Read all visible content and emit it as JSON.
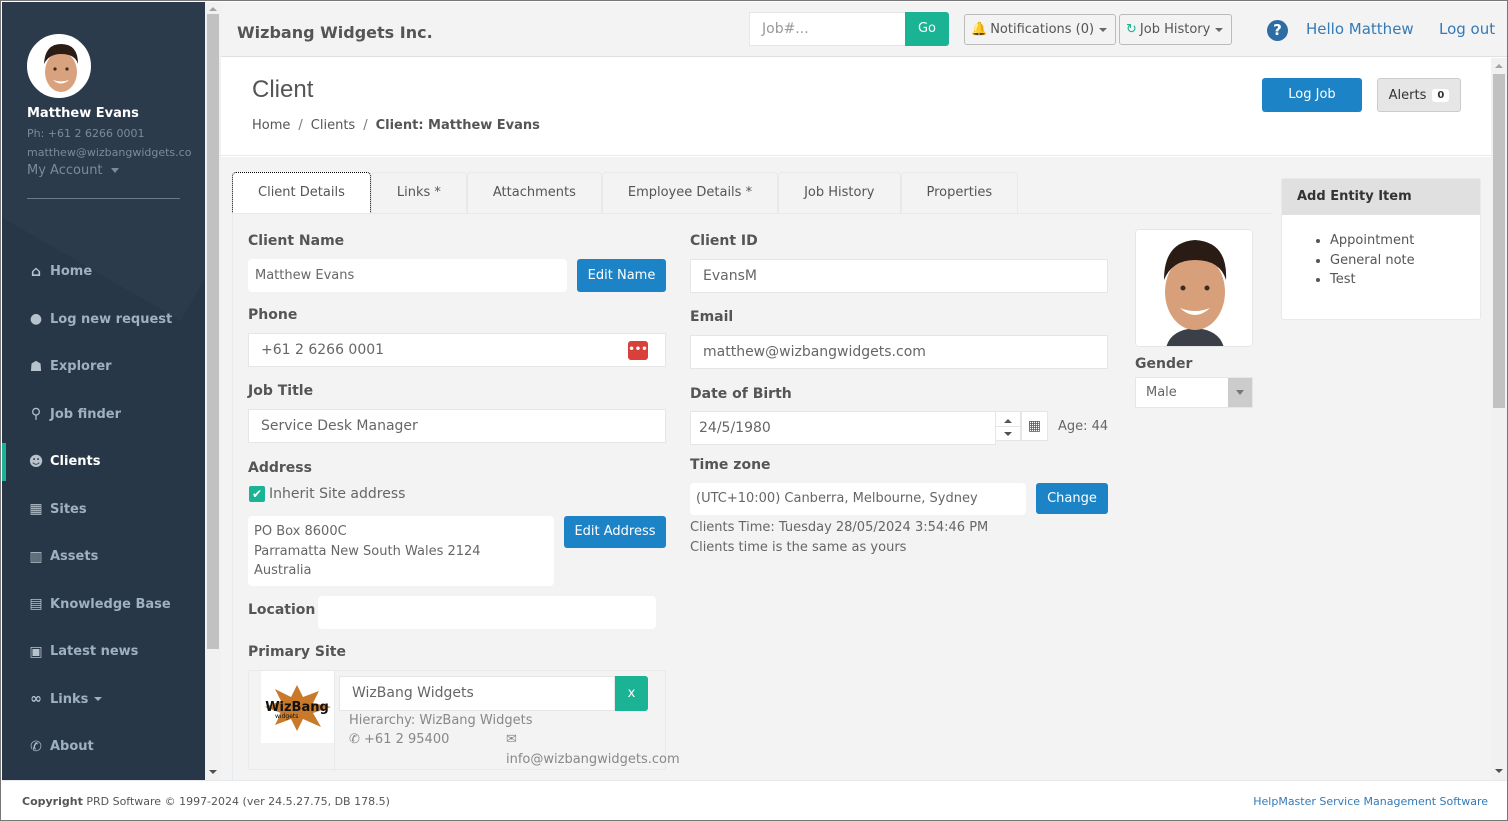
{
  "user": {
    "name": "Matthew Evans",
    "phone": "Ph: +61 2 6266 0001",
    "email": "matthew@wizbangwidgets.co",
    "account_menu": "My Account"
  },
  "sidebar": {
    "items": [
      {
        "label": "Home",
        "icon": "home-icon"
      },
      {
        "label": "Log new request",
        "icon": "circle-icon"
      },
      {
        "label": "Explorer",
        "icon": "explorer-icon"
      },
      {
        "label": "Job finder",
        "icon": "search-icon"
      },
      {
        "label": "Clients",
        "icon": "user-icon",
        "active": true
      },
      {
        "label": "Sites",
        "icon": "building-icon"
      },
      {
        "label": "Assets",
        "icon": "barcode-icon"
      },
      {
        "label": "Knowledge Base",
        "icon": "book-icon"
      },
      {
        "label": "Latest news",
        "icon": "newspaper-icon"
      },
      {
        "label": "Links",
        "icon": "link-icon"
      },
      {
        "label": "About",
        "icon": "phone-icon"
      }
    ]
  },
  "topbar": {
    "brand": "Wizbang Widgets Inc.",
    "job_search_placeholder": "Job#...",
    "go_label": "Go",
    "notifications_label": "Notifications (0)",
    "job_history_label": "Job History",
    "help_glyph": "?",
    "hello": "Hello Matthew",
    "logout": "Log out"
  },
  "header": {
    "title": "Client",
    "breadcrumb": [
      "Home",
      "Clients",
      "Client: Matthew Evans"
    ],
    "log_job_label": "Log Job",
    "alerts_label": "Alerts",
    "alerts_count": "0"
  },
  "tabs": [
    "Client Details",
    "Links *",
    "Attachments",
    "Employee Details *",
    "Job History",
    "Properties"
  ],
  "form": {
    "client_name_label": "Client Name",
    "client_name_value": "Matthew Evans",
    "edit_name_label": "Edit Name",
    "phone_label": "Phone",
    "phone_value": "+61 2 6266 0001",
    "job_title_label": "Job Title",
    "job_title_value": "Service Desk Manager",
    "address_label": "Address",
    "inherit_label": "Inherit Site address",
    "inherit_checked": true,
    "address_lines": [
      "PO Box 8600C",
      "Parramatta New South Wales 2124",
      "Australia"
    ],
    "edit_address_label": "Edit Address",
    "location_label": "Location",
    "location_value": "",
    "primary_site_label": "Primary Site",
    "site_name": "WizBang Widgets",
    "site_clear": "x",
    "site_hierarchy": "Hierarchy: WizBang Widgets",
    "site_phone": "+61 2 95400",
    "site_email": "info@wizbangwidgets.com",
    "site_logo_text": "WizBang",
    "site_logo_sub": "widgets",
    "client_id_label": "Client ID",
    "client_id_value": "EvansM",
    "email_label": "Email",
    "email_value": "matthew@wizbangwidgets.com",
    "dob_label": "Date of Birth",
    "dob_value": "24/5/1980",
    "age": "Age: 44",
    "timezone_label": "Time zone",
    "timezone_value": "(UTC+10:00) Canberra, Melbourne, Sydney",
    "change_label": "Change",
    "clients_time": "Clients Time: Tuesday 28/05/2024 3:54:46 PM",
    "clients_time_note": "Clients time is the same as yours",
    "gender_label": "Gender",
    "gender_value": "Male"
  },
  "entity": {
    "title": "Add Entity Item",
    "items": [
      "Appointment",
      "General note",
      "Test"
    ]
  },
  "footer": {
    "copyright_bold": "Copyright",
    "copyright_rest": " PRD Software © 1997-2024 (ver 24.5.27.75, DB 178.5)",
    "product": "HelpMaster Service Management Software"
  },
  "colors": {
    "sidebar_bg": "#283747",
    "accent_green": "#1ab394",
    "primary_blue": "#1c84c6",
    "link_blue": "#337ab7",
    "phone_ext_red": "#d9403a"
  }
}
